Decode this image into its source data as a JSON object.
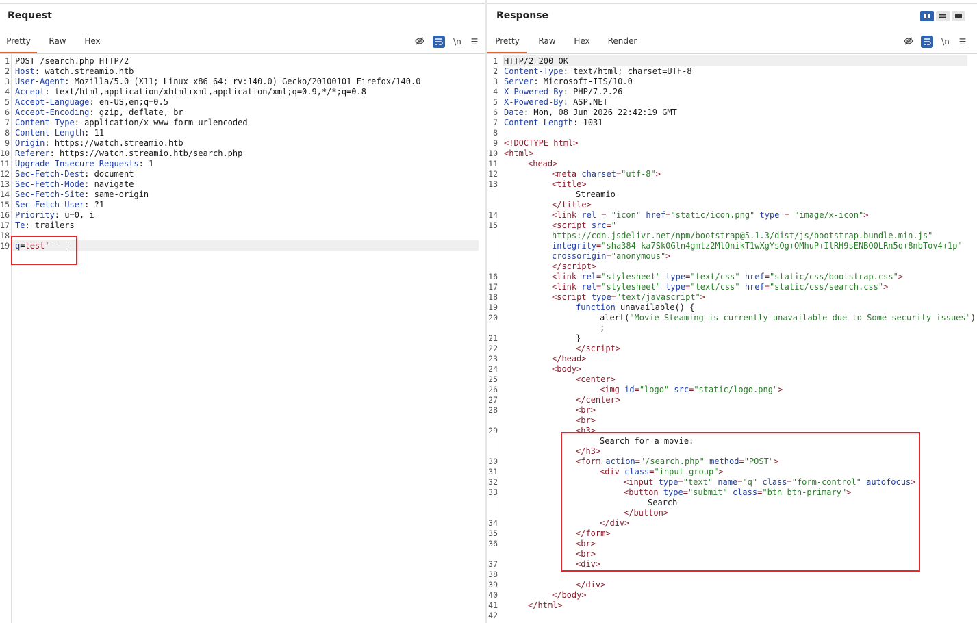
{
  "request": {
    "title": "Request",
    "tabs": [
      "Pretty",
      "Raw",
      "Hex"
    ],
    "active_tab": "Pretty",
    "toolbar": {
      "hide_icon": "eye-off-icon",
      "wrap_icon": "wrap-icon",
      "newline_label": "\\n",
      "menu_icon": "menu-icon"
    },
    "lines": [
      {
        "n": "1",
        "t": "POST /search.php HTTP/2"
      },
      {
        "n": "2",
        "h": "Host",
        "v": " watch.streamio.htb"
      },
      {
        "n": "3",
        "h": "User-Agent",
        "v": " Mozilla/5.0 (X11; Linux x86_64; rv:140.0) Gecko/20100101 Firefox/140.0"
      },
      {
        "n": "4",
        "h": "Accept",
        "v": " text/html,application/xhtml+xml,application/xml;q=0.9,*/*;q=0.8"
      },
      {
        "n": "5",
        "h": "Accept-Language",
        "v": " en-US,en;q=0.5"
      },
      {
        "n": "6",
        "h": "Accept-Encoding",
        "v": " gzip, deflate, br"
      },
      {
        "n": "7",
        "h": "Content-Type",
        "v": " application/x-www-form-urlencoded"
      },
      {
        "n": "8",
        "h": "Content-Length",
        "v": " 11"
      },
      {
        "n": "9",
        "h": "Origin",
        "v": " https://watch.streamio.htb"
      },
      {
        "n": "10",
        "h": "Referer",
        "v": " https://watch.streamio.htb/search.php"
      },
      {
        "n": "11",
        "h": "Upgrade-Insecure-Requests",
        "v": " 1"
      },
      {
        "n": "12",
        "h": "Sec-Fetch-Dest",
        "v": " document"
      },
      {
        "n": "13",
        "h": "Sec-Fetch-Mode",
        "v": " navigate"
      },
      {
        "n": "14",
        "h": "Sec-Fetch-Site",
        "v": " same-origin"
      },
      {
        "n": "15",
        "h": "Sec-Fetch-User",
        "v": " ?1"
      },
      {
        "n": "16",
        "h": "Priority",
        "v": " u=0, i"
      },
      {
        "n": "17",
        "h": "Te",
        "v": " trailers"
      },
      {
        "n": "18",
        "t": ""
      },
      {
        "n": "19",
        "body": true,
        "param": "q",
        "value": "test'-- "
      }
    ]
  },
  "response": {
    "title": "Response",
    "tabs": [
      "Pretty",
      "Raw",
      "Hex",
      "Render"
    ],
    "active_tab": "Pretty",
    "toolbar": {
      "hide_icon": "eye-off-icon",
      "wrap_icon": "wrap-icon",
      "newline_label": "\\n",
      "menu_icon": "menu-icon"
    },
    "layout_icons": [
      "split-vertical-icon",
      "split-horizontal-icon",
      "tabs-layout-icon"
    ],
    "rows": [
      {
        "n": "1",
        "i": 0,
        "s": [
          [
            "t",
            "HTTP/2 200 OK"
          ]
        ]
      },
      {
        "n": "2",
        "i": 0,
        "s": [
          [
            "k",
            "Content-Type"
          ],
          [
            "t",
            ": text/html; charset=UTF-8"
          ]
        ]
      },
      {
        "n": "3",
        "i": 0,
        "s": [
          [
            "k",
            "Server"
          ],
          [
            "t",
            ": Microsoft-IIS/10.0"
          ]
        ]
      },
      {
        "n": "4",
        "i": 0,
        "s": [
          [
            "k",
            "X-Powered-By"
          ],
          [
            "t",
            ": PHP/7.2.26"
          ]
        ]
      },
      {
        "n": "5",
        "i": 0,
        "s": [
          [
            "k",
            "X-Powered-By"
          ],
          [
            "t",
            ": ASP.NET"
          ]
        ]
      },
      {
        "n": "6",
        "i": 0,
        "s": [
          [
            "k",
            "Date"
          ],
          [
            "t",
            ": Mon, 08 Jun 2026 22:42:19 GMT"
          ]
        ]
      },
      {
        "n": "7",
        "i": 0,
        "s": [
          [
            "k",
            "Content-Length"
          ],
          [
            "t",
            ": 1031"
          ]
        ]
      },
      {
        "n": "8",
        "i": 0,
        "s": []
      },
      {
        "n": "9",
        "i": 0,
        "s": [
          [
            "g",
            "<!DOCTYPE html>"
          ]
        ]
      },
      {
        "n": "10",
        "i": 0,
        "s": [
          [
            "g",
            "<"
          ],
          [
            "tg",
            "html"
          ],
          [
            "g",
            ">"
          ]
        ]
      },
      {
        "n": "11",
        "i": 1,
        "s": [
          [
            "g",
            "<"
          ],
          [
            "tg",
            "head"
          ],
          [
            "g",
            ">"
          ]
        ]
      },
      {
        "n": "12",
        "i": 2,
        "s": [
          [
            "g",
            "<"
          ],
          [
            "tg",
            "meta "
          ],
          [
            "a",
            "charset"
          ],
          [
            "g",
            "="
          ],
          [
            "v",
            "\"utf-8\""
          ],
          [
            "g",
            ">"
          ]
        ]
      },
      {
        "n": "13",
        "i": 2,
        "s": [
          [
            "g",
            "<"
          ],
          [
            "tg",
            "title"
          ],
          [
            "g",
            ">"
          ]
        ]
      },
      {
        "n": "",
        "i": 3,
        "s": [
          [
            "t",
            "Streamio"
          ]
        ]
      },
      {
        "n": "",
        "i": 2,
        "s": [
          [
            "g",
            "</"
          ],
          [
            "tg",
            "title"
          ],
          [
            "g",
            ">"
          ]
        ]
      },
      {
        "n": "14",
        "i": 2,
        "s": [
          [
            "g",
            "<"
          ],
          [
            "tg",
            "link "
          ],
          [
            "a",
            "rel"
          ],
          [
            "g",
            " = "
          ],
          [
            "v",
            "\"icon\""
          ],
          [
            "a",
            " href"
          ],
          [
            "g",
            "="
          ],
          [
            "v",
            "\"static/icon.png\""
          ],
          [
            "a",
            " type"
          ],
          [
            "g",
            " = "
          ],
          [
            "v",
            "\"image/x-icon\""
          ],
          [
            "g",
            ">"
          ]
        ]
      },
      {
        "n": "15",
        "i": 2,
        "s": [
          [
            "g",
            "<"
          ],
          [
            "tg",
            "script "
          ],
          [
            "a",
            "src"
          ],
          [
            "g",
            "="
          ],
          [
            "v",
            "\""
          ]
        ]
      },
      {
        "n": "",
        "i": 2,
        "s": [
          [
            "v",
            "https://cdn.jsdelivr.net/npm/bootstrap@5.1.3/dist/js/bootstrap.bundle.min.js\""
          ]
        ]
      },
      {
        "n": "",
        "i": 2,
        "s": [
          [
            "a",
            "integrity"
          ],
          [
            "g",
            "="
          ],
          [
            "v",
            "\"sha384-ka7Sk0Gln4gmtz2MlQnikT1wXgYsOg+OMhuP+IlRH9sENBO0LRn5q+8nbTov4+1p\""
          ]
        ]
      },
      {
        "n": "",
        "i": 2,
        "s": [
          [
            "a",
            "crossorigin"
          ],
          [
            "g",
            "="
          ],
          [
            "v",
            "\"anonymous\""
          ],
          [
            "g",
            ">"
          ]
        ]
      },
      {
        "n": "",
        "i": 2,
        "s": [
          [
            "g",
            "</"
          ],
          [
            "tg",
            "script"
          ],
          [
            "g",
            ">"
          ]
        ]
      },
      {
        "n": "16",
        "i": 2,
        "s": [
          [
            "g",
            "<"
          ],
          [
            "tg",
            "link "
          ],
          [
            "a",
            "rel"
          ],
          [
            "g",
            "="
          ],
          [
            "v",
            "\"stylesheet\""
          ],
          [
            "a",
            " type"
          ],
          [
            "g",
            "="
          ],
          [
            "v",
            "\"text/css\""
          ],
          [
            "a",
            " href"
          ],
          [
            "g",
            "="
          ],
          [
            "v",
            "\"static/css/bootstrap.css\""
          ],
          [
            "g",
            ">"
          ]
        ]
      },
      {
        "n": "17",
        "i": 2,
        "s": [
          [
            "g",
            "<"
          ],
          [
            "tg",
            "link "
          ],
          [
            "a",
            "rel"
          ],
          [
            "g",
            "="
          ],
          [
            "v",
            "\"stylesheet\""
          ],
          [
            "a",
            " type"
          ],
          [
            "g",
            "="
          ],
          [
            "v",
            "\"text/css\""
          ],
          [
            "a",
            " href"
          ],
          [
            "g",
            "="
          ],
          [
            "v",
            "\"static/css/search.css\""
          ],
          [
            "g",
            ">"
          ]
        ]
      },
      {
        "n": "18",
        "i": 2,
        "s": [
          [
            "g",
            "<"
          ],
          [
            "tg",
            "script "
          ],
          [
            "a",
            "type"
          ],
          [
            "g",
            "="
          ],
          [
            "v",
            "\"text/javascript\""
          ],
          [
            "g",
            ">"
          ]
        ]
      },
      {
        "n": "19",
        "i": 3,
        "s": [
          [
            "k",
            "function"
          ],
          [
            "t",
            " unavailable() {"
          ]
        ]
      },
      {
        "n": "20",
        "i": 4,
        "s": [
          [
            "t",
            "alert("
          ],
          [
            "v",
            "\"Movie Steaming is currently unavailable due to Some security issues\""
          ],
          [
            "t",
            ")"
          ]
        ]
      },
      {
        "n": "",
        "i": 4,
        "s": [
          [
            "t",
            ";"
          ]
        ]
      },
      {
        "n": "21",
        "i": 3,
        "s": [
          [
            "t",
            "}"
          ]
        ]
      },
      {
        "n": "22",
        "i": 3,
        "s": [
          [
            "g",
            "</"
          ],
          [
            "tg",
            "script"
          ],
          [
            "g",
            ">"
          ]
        ]
      },
      {
        "n": "23",
        "i": 2,
        "s": [
          [
            "g",
            "</"
          ],
          [
            "tg",
            "head"
          ],
          [
            "g",
            ">"
          ]
        ]
      },
      {
        "n": "24",
        "i": 2,
        "s": [
          [
            "g",
            "<"
          ],
          [
            "tg",
            "body"
          ],
          [
            "g",
            ">"
          ]
        ]
      },
      {
        "n": "25",
        "i": 3,
        "s": [
          [
            "g",
            "<"
          ],
          [
            "tg",
            "center"
          ],
          [
            "g",
            ">"
          ]
        ]
      },
      {
        "n": "26",
        "i": 4,
        "s": [
          [
            "g",
            "<"
          ],
          [
            "tg",
            "img "
          ],
          [
            "a",
            "id"
          ],
          [
            "g",
            "="
          ],
          [
            "v",
            "\"logo\""
          ],
          [
            "a",
            " src"
          ],
          [
            "g",
            "="
          ],
          [
            "v",
            "\"static/logo.png\""
          ],
          [
            "g",
            ">"
          ]
        ]
      },
      {
        "n": "27",
        "i": 3,
        "s": [
          [
            "g",
            "</"
          ],
          [
            "tg",
            "center"
          ],
          [
            "g",
            ">"
          ]
        ]
      },
      {
        "n": "28",
        "i": 3,
        "s": [
          [
            "g",
            "<"
          ],
          [
            "tg",
            "br"
          ],
          [
            "g",
            ">"
          ]
        ]
      },
      {
        "n": "",
        "i": 3,
        "s": [
          [
            "g",
            "<"
          ],
          [
            "tg",
            "br"
          ],
          [
            "g",
            ">"
          ]
        ]
      },
      {
        "n": "29",
        "i": 3,
        "s": [
          [
            "g",
            "<"
          ],
          [
            "tg",
            "h3"
          ],
          [
            "g",
            ">"
          ]
        ]
      },
      {
        "n": "",
        "i": 4,
        "s": [
          [
            "t",
            "Search for a movie:"
          ]
        ]
      },
      {
        "n": "",
        "i": 3,
        "s": [
          [
            "g",
            "</"
          ],
          [
            "tg",
            "h3"
          ],
          [
            "g",
            ">"
          ]
        ]
      },
      {
        "n": "30",
        "i": 3,
        "s": [
          [
            "g",
            "<"
          ],
          [
            "tg",
            "form "
          ],
          [
            "a",
            "action"
          ],
          [
            "g",
            "="
          ],
          [
            "v",
            "\"/search.php\""
          ],
          [
            "a",
            " method"
          ],
          [
            "g",
            "="
          ],
          [
            "v",
            "\"POST\""
          ],
          [
            "g",
            ">"
          ]
        ]
      },
      {
        "n": "31",
        "i": 4,
        "s": [
          [
            "g",
            "<"
          ],
          [
            "tg",
            "div "
          ],
          [
            "a",
            "class"
          ],
          [
            "g",
            "="
          ],
          [
            "v",
            "\"input-group\""
          ],
          [
            "g",
            ">"
          ]
        ]
      },
      {
        "n": "32",
        "i": 5,
        "s": [
          [
            "g",
            "<"
          ],
          [
            "tg",
            "input "
          ],
          [
            "a",
            "type"
          ],
          [
            "g",
            "="
          ],
          [
            "v",
            "\"text\""
          ],
          [
            "a",
            " name"
          ],
          [
            "g",
            "="
          ],
          [
            "v",
            "\"q\""
          ],
          [
            "a",
            " class"
          ],
          [
            "g",
            "="
          ],
          [
            "v",
            "\"form-control\""
          ],
          [
            "a",
            " autofocus"
          ],
          [
            "g",
            ">"
          ]
        ]
      },
      {
        "n": "33",
        "i": 5,
        "s": [
          [
            "g",
            "<"
          ],
          [
            "tg",
            "button "
          ],
          [
            "a",
            "type"
          ],
          [
            "g",
            "="
          ],
          [
            "v",
            "\"submit\""
          ],
          [
            "a",
            " class"
          ],
          [
            "g",
            "="
          ],
          [
            "v",
            "\"btn btn-primary\""
          ],
          [
            "g",
            ">"
          ]
        ]
      },
      {
        "n": "",
        "i": 6,
        "s": [
          [
            "t",
            "Search"
          ]
        ]
      },
      {
        "n": "",
        "i": 5,
        "s": [
          [
            "g",
            "</"
          ],
          [
            "tg",
            "button"
          ],
          [
            "g",
            ">"
          ]
        ]
      },
      {
        "n": "34",
        "i": 4,
        "s": [
          [
            "g",
            "</"
          ],
          [
            "tg",
            "div"
          ],
          [
            "g",
            ">"
          ]
        ]
      },
      {
        "n": "35",
        "i": 3,
        "s": [
          [
            "g",
            "</"
          ],
          [
            "tg",
            "form"
          ],
          [
            "g",
            ">"
          ]
        ]
      },
      {
        "n": "36",
        "i": 3,
        "s": [
          [
            "g",
            "<"
          ],
          [
            "tg",
            "br"
          ],
          [
            "g",
            ">"
          ]
        ]
      },
      {
        "n": "",
        "i": 3,
        "s": [
          [
            "g",
            "<"
          ],
          [
            "tg",
            "br"
          ],
          [
            "g",
            ">"
          ]
        ]
      },
      {
        "n": "37",
        "i": 3,
        "s": [
          [
            "g",
            "<"
          ],
          [
            "tg",
            "div"
          ],
          [
            "g",
            ">"
          ]
        ]
      },
      {
        "n": "38",
        "i": 0,
        "s": []
      },
      {
        "n": "39",
        "i": 3,
        "s": [
          [
            "g",
            "</"
          ],
          [
            "tg",
            "div"
          ],
          [
            "g",
            ">"
          ]
        ]
      },
      {
        "n": "40",
        "i": 2,
        "s": [
          [
            "g",
            "</"
          ],
          [
            "tg",
            "body"
          ],
          [
            "g",
            ">"
          ]
        ]
      },
      {
        "n": "41",
        "i": 1,
        "s": [
          [
            "g",
            "</"
          ],
          [
            "tg",
            "html"
          ],
          [
            "g",
            ">"
          ]
        ]
      },
      {
        "n": "42",
        "i": 0,
        "s": []
      }
    ]
  },
  "colors": {
    "accent_tab": "#e8622c",
    "highlight_box": "#e5262d",
    "toolbar_blue": "#2f63b0",
    "header_key": "#1f3fa8",
    "tag": "#8a1e2d",
    "string": "#2b7d2b"
  }
}
